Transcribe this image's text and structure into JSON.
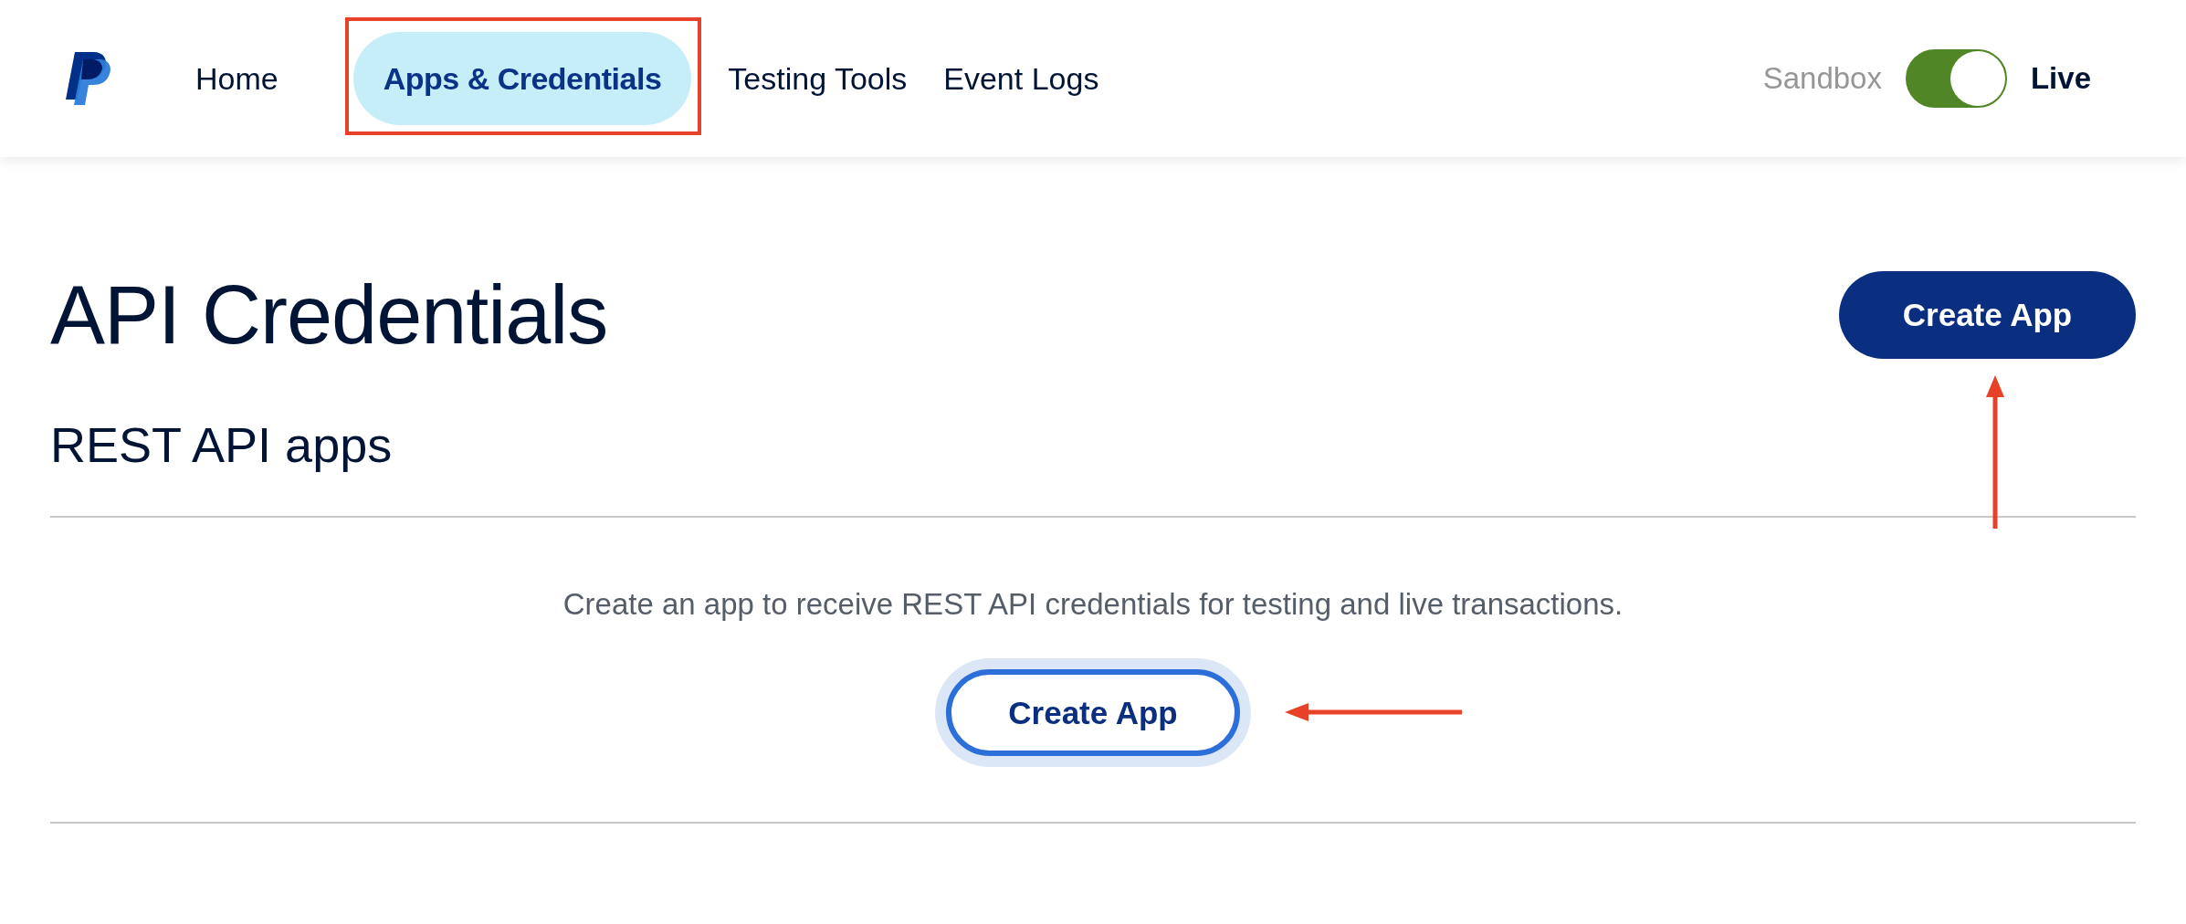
{
  "nav": {
    "items": [
      {
        "label": "Home",
        "selected": false
      },
      {
        "label": "Apps & Credentials",
        "selected": true
      },
      {
        "label": "Testing Tools",
        "selected": false
      },
      {
        "label": "Event Logs",
        "selected": false
      }
    ]
  },
  "environment": {
    "left_label": "Sandbox",
    "right_label": "Live",
    "on": true
  },
  "page": {
    "title": "API Credentials",
    "header_button": "Create App"
  },
  "section": {
    "title": "REST API apps",
    "empty_text": "Create an app to receive REST API credentials for testing and live transactions.",
    "button": "Create App",
    "button_focused": true
  },
  "annotations": [
    {
      "kind": "box"
    },
    {
      "kind": "arrow-up"
    },
    {
      "kind": "arrow-left"
    }
  ]
}
